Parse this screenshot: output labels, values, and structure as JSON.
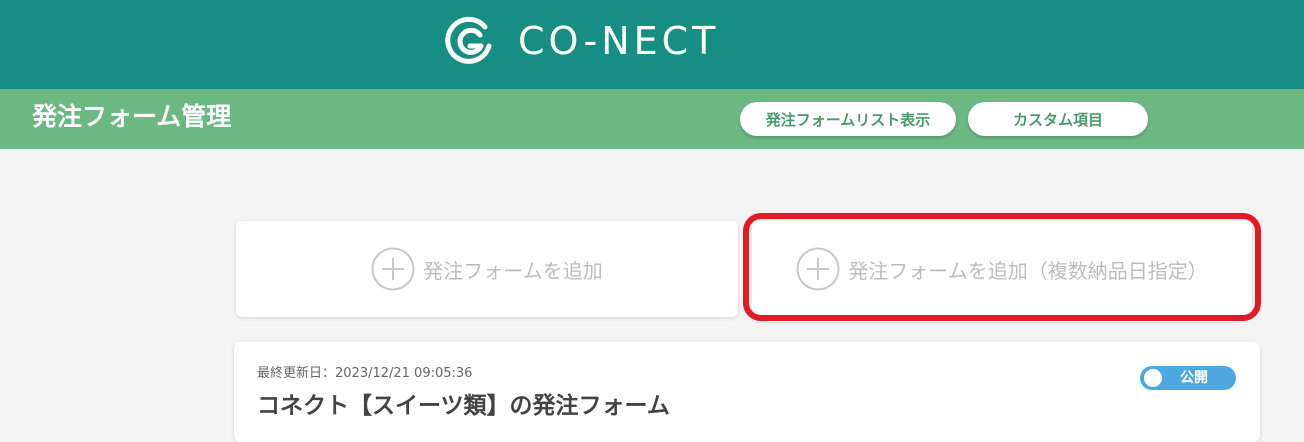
{
  "header": {
    "brand": "CO-NECT",
    "logo_icon": "co-nect-logo-icon"
  },
  "subheader": {
    "title": "発注フォーム管理",
    "list_button": "発注フォームリスト表示",
    "custom_button": "カスタム項目"
  },
  "actions": {
    "add_form": "発注フォームを追加",
    "add_form_multi": "発注フォームを追加（複数納品日指定）",
    "icon": "plus-circle-icon"
  },
  "form_card": {
    "updated": "最終更新日：2023/12/21 09:05:36",
    "title": "コネクト【スイーツ類】の発注フォーム",
    "status": "公開",
    "status_on": true
  },
  "colors": {
    "header": "#168e83",
    "subheader": "#6bb883",
    "highlight": "#e01b24",
    "toggle": "#4ea8e0"
  }
}
